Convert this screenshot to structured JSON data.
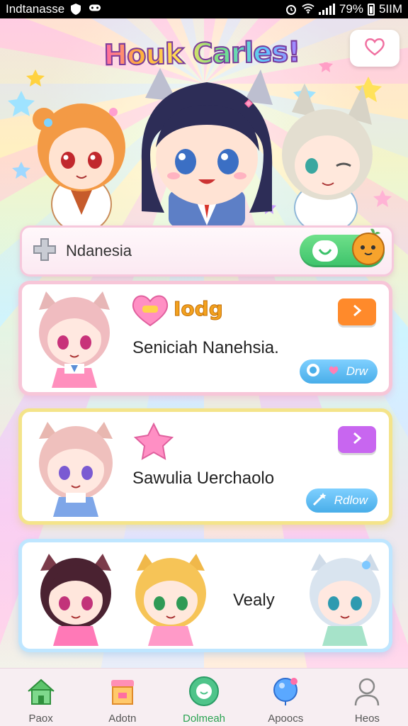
{
  "status_bar": {
    "carrier": "Indtanasse",
    "battery_percent": "79%",
    "time": "5IIM"
  },
  "header": {
    "title": "Houk Carles!"
  },
  "search": {
    "value": "Ndanesia"
  },
  "cards": [
    {
      "tag": "Iodg",
      "name": "Seniciah Nanehsia.",
      "button": "Drw",
      "accent": "#f7c6d8",
      "arrow_color": "#ff8a2b"
    },
    {
      "tag": "",
      "name": "Sawulia Uerchaolo",
      "button": "Rdlow",
      "accent": "#f4e48a",
      "arrow_color": "#c866f0"
    },
    {
      "tag": "",
      "name": "Vealy",
      "button": "",
      "accent": "#bfe6ff",
      "arrow_color": ""
    }
  ],
  "nav": [
    {
      "label": "Paox",
      "icon": "house-icon"
    },
    {
      "label": "Adotn",
      "icon": "shop-icon"
    },
    {
      "label": "Dolmeah",
      "icon": "chat-icon",
      "active": true
    },
    {
      "label": "Apoocs",
      "icon": "balloon-icon"
    },
    {
      "label": "Heos",
      "icon": "profile-icon"
    }
  ]
}
